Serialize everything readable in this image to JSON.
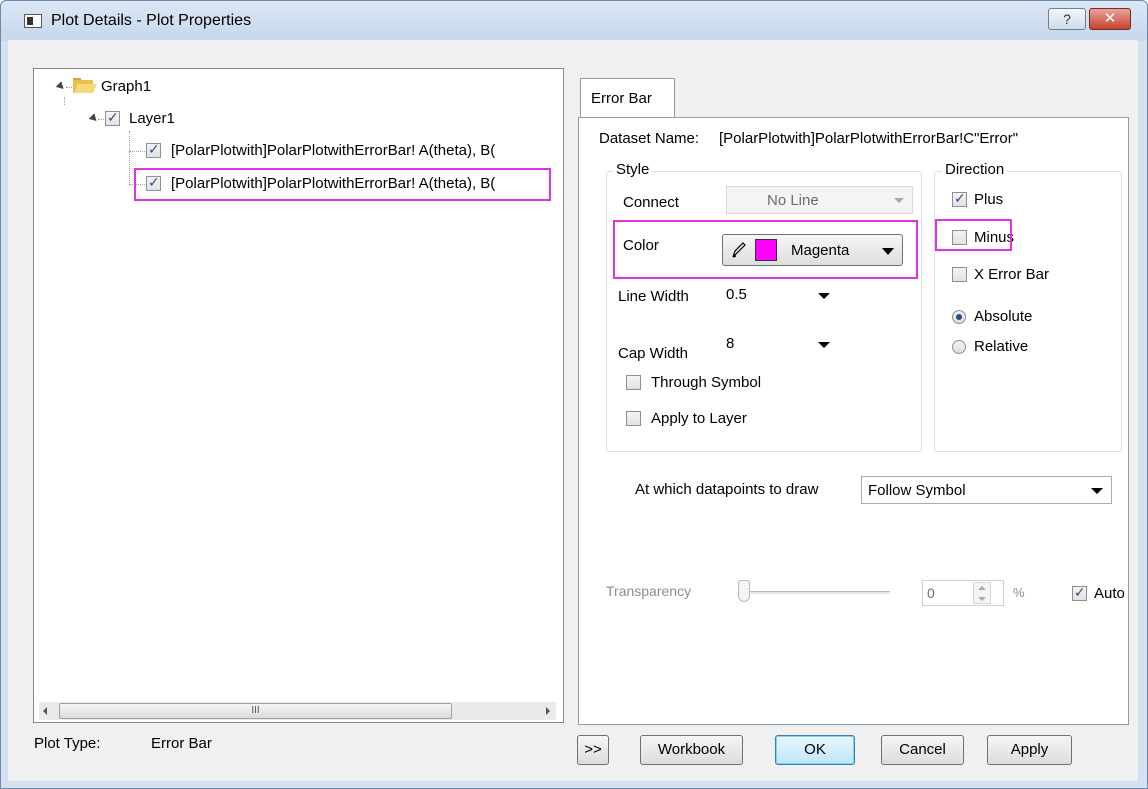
{
  "window": {
    "title": "Plot Details - Plot Properties",
    "help_label": "?",
    "close_label": "✕"
  },
  "tree": {
    "root": "Graph1",
    "layer": "Layer1",
    "items": [
      {
        "label": "[PolarPlotwith]PolarPlotwithErrorBar! A(theta), B(",
        "checked": true
      },
      {
        "label": "[PolarPlotwith]PolarPlotwithErrorBar! A(theta), B(",
        "checked": true
      }
    ],
    "scroll_grip": "III"
  },
  "footer": {
    "plot_type_label": "Plot Type:",
    "plot_type_value": "Error Bar"
  },
  "tab": {
    "label": "Error Bar"
  },
  "error_bar": {
    "dataset_label": "Dataset Name:",
    "dataset_name": "[PolarPlotwith]PolarPlotwithErrorBar!C\"Error\"",
    "style": {
      "title": "Style",
      "connect_label": "Connect",
      "connect_value": "No Line",
      "color_label": "Color",
      "color_value": "Magenta",
      "color_hex": "#ff00ff",
      "line_width_label": "Line Width",
      "line_width_value": "0.5",
      "cap_width_label": "Cap Width",
      "cap_width_value": "8",
      "through_symbol_label": "Through Symbol",
      "through_symbol_checked": false,
      "apply_to_layer_label": "Apply to Layer",
      "apply_to_layer_checked": false
    },
    "direction": {
      "title": "Direction",
      "plus_label": "Plus",
      "plus_checked": true,
      "minus_label": "Minus",
      "minus_checked": false,
      "x_error_label": "X Error Bar",
      "x_error_checked": false,
      "absolute_label": "Absolute",
      "relative_label": "Relative",
      "selected": "Absolute"
    },
    "datapoints_label": "At which datapoints to draw",
    "datapoints_value": "Follow Symbol",
    "transparency_label": "Transparency",
    "transparency_value": "0",
    "transparency_unit": "%",
    "auto_label": "Auto",
    "auto_checked": true
  },
  "buttons": {
    "expand": ">>",
    "workbook": "Workbook",
    "ok": "OK",
    "cancel": "Cancel",
    "apply": "Apply"
  },
  "highlight_color": "#e033e0"
}
